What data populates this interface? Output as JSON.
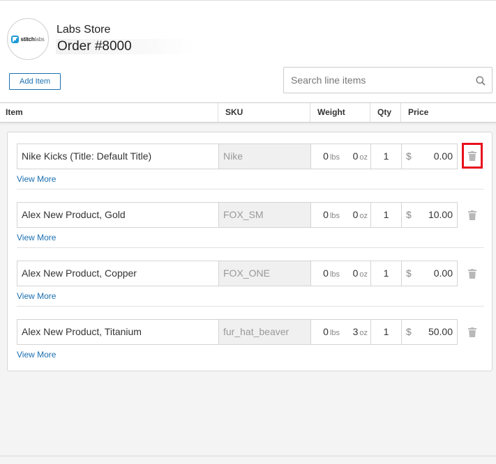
{
  "header": {
    "logo": {
      "brand": "stitch",
      "brand_suffix": "labs",
      "icon": "stitchlabs-logo"
    },
    "store_name": "Labs Store",
    "order_number": "Order #8000",
    "add_item_label": "Add Item",
    "search": {
      "placeholder": "Search line items",
      "value": "",
      "icon": "search-icon"
    }
  },
  "table": {
    "columns": [
      "Item",
      "SKU",
      "Weight",
      "Qty",
      "Price"
    ],
    "view_more_label": "View More",
    "weight_units": {
      "lbs": "lbs",
      "oz": "oz"
    },
    "currency": "$",
    "rows": [
      {
        "name": "Nike Kicks (Title: Default Title)",
        "sku": "Nike",
        "lbs": "0",
        "oz": "0",
        "qty": "1",
        "price": "0.00",
        "delete_highlighted": true
      },
      {
        "name": "Alex New Product, Gold",
        "sku": "FOX_SM",
        "lbs": "0",
        "oz": "0",
        "qty": "1",
        "price": "10.00",
        "delete_highlighted": false
      },
      {
        "name": "Alex New Product, Copper",
        "sku": "FOX_ONE",
        "lbs": "0",
        "oz": "0",
        "qty": "1",
        "price": "0.00",
        "delete_highlighted": false
      },
      {
        "name": "Alex New Product, Titanium",
        "sku": "fur_hat_beaver",
        "lbs": "0",
        "oz": "3",
        "qty": "1",
        "price": "50.00",
        "delete_highlighted": false
      }
    ]
  },
  "colors": {
    "accent": "#1a6fb0",
    "highlight": "#e8101c",
    "logo_blue": "#1c9ad6"
  }
}
